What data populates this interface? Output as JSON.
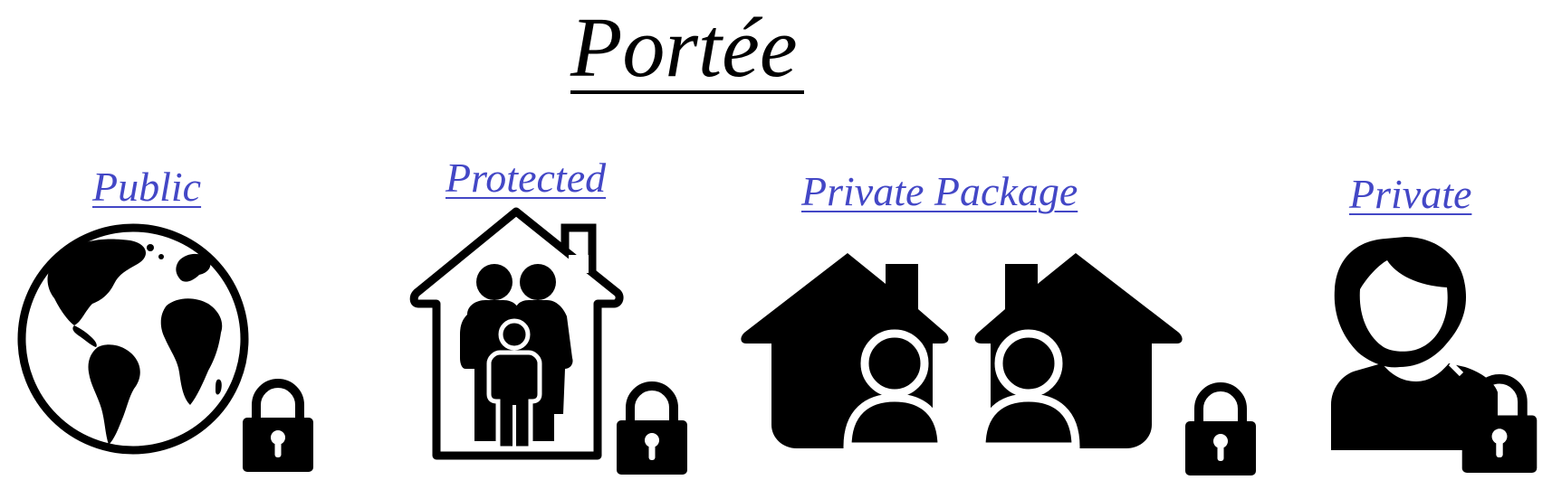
{
  "title": "Portée",
  "accent_color": "#4347c6",
  "scopes": [
    {
      "label": "Public",
      "icon": "globe-icon",
      "lock": "padlock-icon"
    },
    {
      "label": "Protected",
      "icon": "family-house-icon",
      "lock": "padlock-icon"
    },
    {
      "label": "Private Package",
      "icon": "houses-users-icon",
      "lock": "padlock-icon"
    },
    {
      "label": "Private",
      "icon": "user-icon",
      "lock": "padlock-icon"
    }
  ]
}
